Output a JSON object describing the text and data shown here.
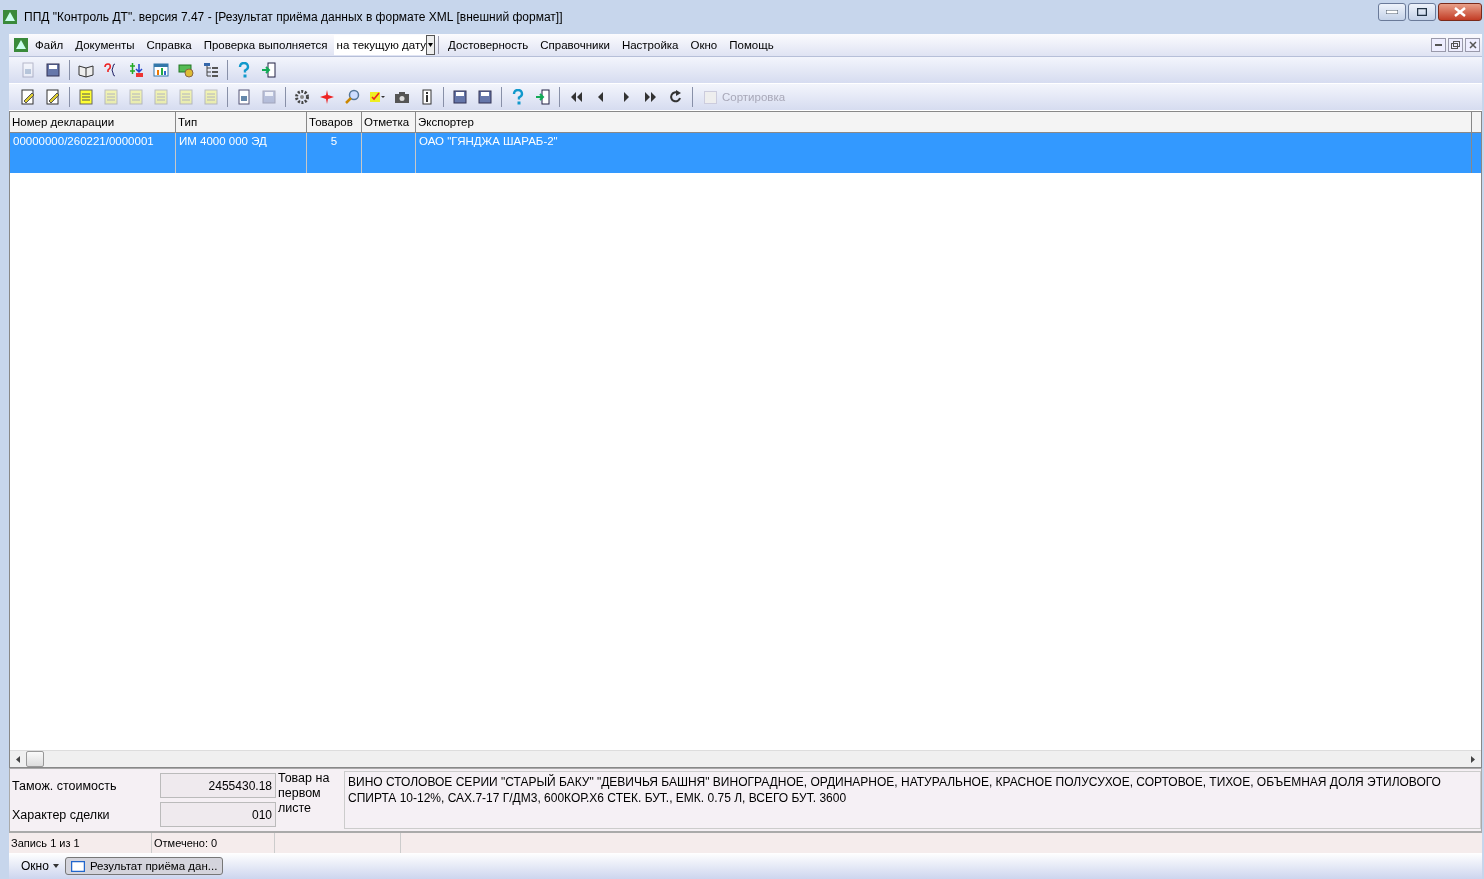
{
  "window": {
    "title": "ППД \"Контроль ДТ\". версия 7.47 - [Результат приёма данных в формате XML [внешний формат]]"
  },
  "menu": {
    "items": [
      "Файл",
      "Документы",
      "Справка",
      "Проверка выполняется"
    ],
    "date_mode": {
      "value": "на текущую дату"
    },
    "items_after": [
      "Достоверность",
      "Справочники",
      "Настройка",
      "Окно",
      "Помощь"
    ]
  },
  "toolbars": [
    {
      "buttons": [
        {
          "kind": "doc",
          "disabled": true
        },
        {
          "kind": "save",
          "disabled": false
        },
        {
          "kind": "sep"
        },
        {
          "kind": "book",
          "disabled": false
        },
        {
          "kind": "query",
          "disabled": false
        },
        {
          "kind": "money",
          "disabled": false
        },
        {
          "kind": "chart",
          "disabled": false
        },
        {
          "kind": "cash",
          "disabled": false
        },
        {
          "kind": "tree",
          "disabled": false
        },
        {
          "kind": "sep"
        },
        {
          "kind": "help",
          "disabled": false
        },
        {
          "kind": "exit",
          "disabled": false
        }
      ]
    },
    {
      "buttons": [
        {
          "kind": "edit",
          "disabled": false
        },
        {
          "kind": "edit",
          "disabled": false
        },
        {
          "kind": "sep"
        },
        {
          "kind": "form",
          "disabled": false
        },
        {
          "kind": "form",
          "disabled": true
        },
        {
          "kind": "form",
          "disabled": true
        },
        {
          "kind": "form",
          "disabled": true
        },
        {
          "kind": "form",
          "disabled": true
        },
        {
          "kind": "form",
          "disabled": true
        },
        {
          "kind": "sep"
        },
        {
          "kind": "doc",
          "disabled": false
        },
        {
          "kind": "save",
          "disabled": true
        },
        {
          "kind": "sep"
        },
        {
          "kind": "gear",
          "disabled": false
        },
        {
          "kind": "star",
          "disabled": false
        },
        {
          "kind": "magnifier",
          "disabled": false
        },
        {
          "kind": "check",
          "disabled": false
        },
        {
          "kind": "camera",
          "disabled": false
        },
        {
          "kind": "info",
          "disabled": false
        },
        {
          "kind": "sep"
        },
        {
          "kind": "save",
          "disabled": false
        },
        {
          "kind": "save",
          "disabled": false
        },
        {
          "kind": "sep"
        },
        {
          "kind": "help",
          "disabled": false
        },
        {
          "kind": "exit",
          "disabled": false
        },
        {
          "kind": "sep"
        },
        {
          "kind": "first",
          "disabled": false
        },
        {
          "kind": "prev",
          "disabled": false
        },
        {
          "kind": "next",
          "disabled": false
        },
        {
          "kind": "last",
          "disabled": false
        },
        {
          "kind": "refresh",
          "disabled": false
        },
        {
          "kind": "sep"
        }
      ],
      "sort_checkbox": {
        "label": "Сортировка",
        "checked": false,
        "disabled": true
      }
    }
  ],
  "table": {
    "columns": [
      "Номер декларации",
      "Тип",
      "Товаров",
      "Отметка",
      "Экспортер"
    ],
    "rows": [
      {
        "selected": true,
        "cells": [
          "00000000/260221/0000001",
          "ИМ 4000 000 ЭД",
          "5",
          "",
          "ОАО \"ГЯНДЖА ШАРАБ-2\""
        ]
      }
    ]
  },
  "details": {
    "customs_value_label": "Тамож. стоимость",
    "customs_value": "2455430.18",
    "deal_type_label": "Характер сделки",
    "deal_type": "010",
    "goods_label": "Товар на первом листе",
    "goods_text": "ВИНО СТОЛОВОЕ СЕРИИ \"СТАРЫЙ БАКУ\" \"ДЕВИЧЬЯ БАШНЯ\" ВИНОГРАДНОЕ, ОРДИНАРНОЕ, НАТУРАЛЬНОЕ, КРАСНОЕ ПОЛУСУХОЕ, СОРТОВОЕ, ТИХОЕ, ОБЪЕМНАЯ ДОЛЯ ЭТИЛОВОГО СПИРТА 10-12%, САХ.7-17 Г/ДМ3, 600КОР.Х6 СТЕК. БУТ., ЕМК. 0.75 Л, ВСЕГО БУТ. 3600"
  },
  "status_bar": [
    "Запись 1 из 1",
    "Отмечено: 0"
  ],
  "taskbar": {
    "menu": "Окно",
    "windows": [
      {
        "title": "Результат приёма дан...",
        "selected": true
      }
    ]
  }
}
